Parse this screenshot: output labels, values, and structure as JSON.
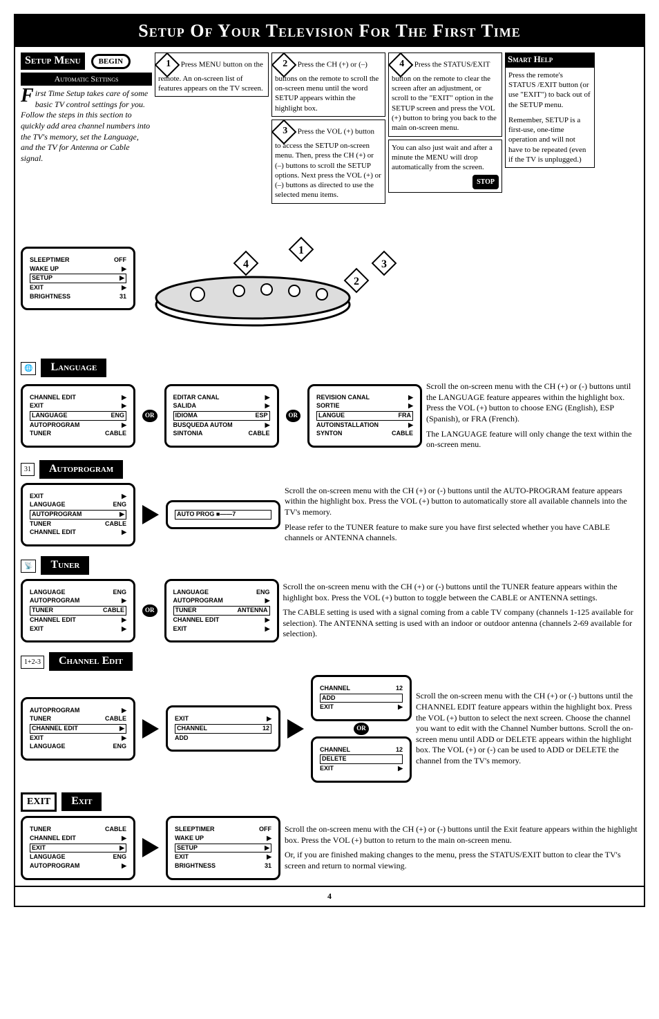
{
  "title": "Setup Of Your Television For The First Time",
  "page_number": "4",
  "setup_menu": {
    "heading": "Setup Menu",
    "begin": "BEGIN",
    "auto_settings": "Automatic Settings",
    "intro": "irst Time Setup takes care of some basic TV control settings for you. Follow the steps in this section to quickly add area channel numbers into the TV's memory, set the Language, and the TV for Antenna or Cable signal.",
    "screen": {
      "r1a": "SLEEPTIMER",
      "r1b": "OFF",
      "r2a": "WAKE UP",
      "r2b": "▶",
      "r3a": "SETUP",
      "r3b": "▶",
      "r4a": "EXIT",
      "r4b": "▶",
      "r5a": "BRIGHTNESS",
      "r5b": "31"
    }
  },
  "step1": "Press MENU button on the remote. An on-screen list of features appears on the TV screen.",
  "step2": "Press the CH (+) or (–) buttons on the remote to scroll the on-screen menu until the word SETUP appears within the highlight box.",
  "step3": "Press the VOL (+) button to access the SETUP on-screen menu. Then, press the CH (+) or (–) buttons to scroll the SETUP options. Next press the VOL (+) or (–) buttons as directed to use the selected menu items.",
  "step4": "Press the STATUS/EXIT button on the remote to clear the screen after an adjustment, or scroll to the \"EXIT\" option in the SETUP screen and press the VOL (+) button to bring you back to the main on-screen menu.",
  "step4b": "You can also just wait and after a minute the MENU will drop automatically from the screen.",
  "stop": "STOP",
  "help": {
    "title": "Smart Help",
    "p1": "Press the remote's STATUS /EXIT button (or use \"EXIT\") to back out of the SETUP menu.",
    "p2": "Remember, SETUP is a first-use, one-time operation and will not have to be repeated (even if the TV is unplugged.)"
  },
  "language": {
    "title": "Language",
    "text1": "Scroll the on-screen menu with the CH (+) or (-) buttons until the LANGUAGE feature appeares within the highlight box. Press the VOL (+) button to choose ENG (English), ESP (Spanish), or FRA (French).",
    "text2": "The LANGUAGE feature will only change the text within the on-screen menu.",
    "s1": {
      "r1a": "CHANNEL EDIT",
      "r1b": "▶",
      "r2a": "EXIT",
      "r2b": "▶",
      "r3a": "LANGUAGE",
      "r3b": "ENG",
      "r4a": "AUTOPROGRAM",
      "r4b": "▶",
      "r5a": "TUNER",
      "r5b": "CABLE"
    },
    "s2": {
      "r1a": "EDITAR CANAL",
      "r1b": "▶",
      "r2a": "SALIDA",
      "r2b": "▶",
      "r3a": "IDIOMA",
      "r3b": "ESP",
      "r4a": "BUSQUEDA AUTOM",
      "r4b": "▶",
      "r5a": "SINTONIA",
      "r5b": "CABLE"
    },
    "s3": {
      "r1a": "REVISION CANAL",
      "r1b": "▶",
      "r2a": "SORTIE",
      "r2b": "▶",
      "r3a": "LANGUE",
      "r3b": "FRA",
      "r4a": "AUTOINSTALLATION",
      "r4b": "▶",
      "r5a": "SYNTON",
      "r5b": "CABLE"
    }
  },
  "autoprogram": {
    "title": "Autoprogram",
    "icon": "31",
    "text1": "Scroll the on-screen menu with the CH (+) or (-) buttons until the AUTO-PROGRAM feature appears within the highlight box. Press the VOL (+) button to automatically store all available channels into the TV's memory.",
    "text2": "Please refer to the TUNER feature to make sure you have first selected whether you have CABLE channels or ANTENNA channels.",
    "s1": {
      "r1a": "EXIT",
      "r1b": "▶",
      "r2a": "LANGUAGE",
      "r2b": "ENG",
      "r3a": "AUTOPROGRAM",
      "r3b": "▶",
      "r4a": "TUNER",
      "r4b": "CABLE",
      "r5a": "CHANNEL EDIT",
      "r5b": "▶"
    },
    "s2": {
      "r1a": "AUTO PROG ■——7",
      "r1b": ""
    }
  },
  "tuner": {
    "title": "Tuner",
    "text1": "Scroll the on-screen menu with the CH (+) or (-) buttons until the TUNER feature appears within the highlight box. Press the VOL (+) button to toggle between the CABLE or ANTENNA settings.",
    "text2": "The CABLE setting is used with a signal coming from a cable TV company (channels 1-125 available for selection). The ANTENNA setting is used with an indoor or outdoor antenna (channels 2-69 available for selection).",
    "s1": {
      "r1a": "LANGUAGE",
      "r1b": "ENG",
      "r2a": "AUTOPROGRAM",
      "r2b": "▶",
      "r3a": "TUNER",
      "r3b": "CABLE",
      "r4a": "CHANNEL EDIT",
      "r4b": "▶",
      "r5a": "EXIT",
      "r5b": "▶"
    },
    "s2": {
      "r1a": "LANGUAGE",
      "r1b": "ENG",
      "r2a": "AUTOPROGRAM",
      "r2b": "▶",
      "r3a": "TUNER",
      "r3b": "ANTENNA",
      "r4a": "CHANNEL EDIT",
      "r4b": "▶",
      "r5a": "EXIT",
      "r5b": "▶"
    }
  },
  "channel_edit": {
    "title": "Channel Edit",
    "icon": "1+2-3",
    "text": "Scroll the on-screen menu with the CH (+) or (-) buttons until the CHANNEL EDIT feature appears within the highlight box. Press the VOL (+) button to select the next screen. Choose the channel you want to edit with the Channel Number buttons. Scroll the on-screen menu until ADD or DELETE appears within the highlight box. The VOL (+) or (-) can be used to ADD or DELETE the channel from the TV's memory.",
    "s1": {
      "r1a": "AUTOPROGRAM",
      "r1b": "▶",
      "r2a": "TUNER",
      "r2b": "CABLE",
      "r3a": "CHANNEL EDIT",
      "r3b": "▶",
      "r4a": "EXIT",
      "r4b": "▶",
      "r5a": "LANGUAGE",
      "r5b": "ENG"
    },
    "s2": {
      "r1a": "EXIT",
      "r1b": "▶",
      "r2a": "CHANNEL",
      "r2b": "12",
      "r3a": "ADD",
      "r3b": ""
    },
    "s3a": {
      "r1a": "CHANNEL",
      "r1b": "12",
      "r2a": "ADD",
      "r2b": "",
      "r3a": "EXIT",
      "r3b": "▶"
    },
    "s3b": {
      "r1a": "CHANNEL",
      "r1b": "12",
      "r2a": "DELETE",
      "r2b": "",
      "r3a": "EXIT",
      "r3b": "▶"
    }
  },
  "exit": {
    "title": "Exit",
    "icon": "EXIT",
    "text1": "Scroll the on-screen menu with the CH (+) or (-) buttons until the Exit feature appears within the highlight box. Press the VOL (+) button to return to the main on-screen menu.",
    "text2": "Or, if you are finished making changes to the menu, press the STATUS/EXIT button to clear the TV's screen and return to normal viewing.",
    "s1": {
      "r1a": "TUNER",
      "r1b": "CABLE",
      "r2a": "CHANNEL EDIT",
      "r2b": "▶",
      "r3a": "EXIT",
      "r3b": "▶",
      "r4a": "LANGUAGE",
      "r4b": "ENG",
      "r5a": "AUTOPROGRAM",
      "r5b": "▶"
    },
    "s2": {
      "r1a": "SLEEPTIMER",
      "r1b": "OFF",
      "r2a": "WAKE UP",
      "r2b": "▶",
      "r3a": "SETUP",
      "r3b": "▶",
      "r4a": "EXIT",
      "r4b": "▶",
      "r5a": "BRIGHTNESS",
      "r5b": "31"
    }
  },
  "or": "OR"
}
